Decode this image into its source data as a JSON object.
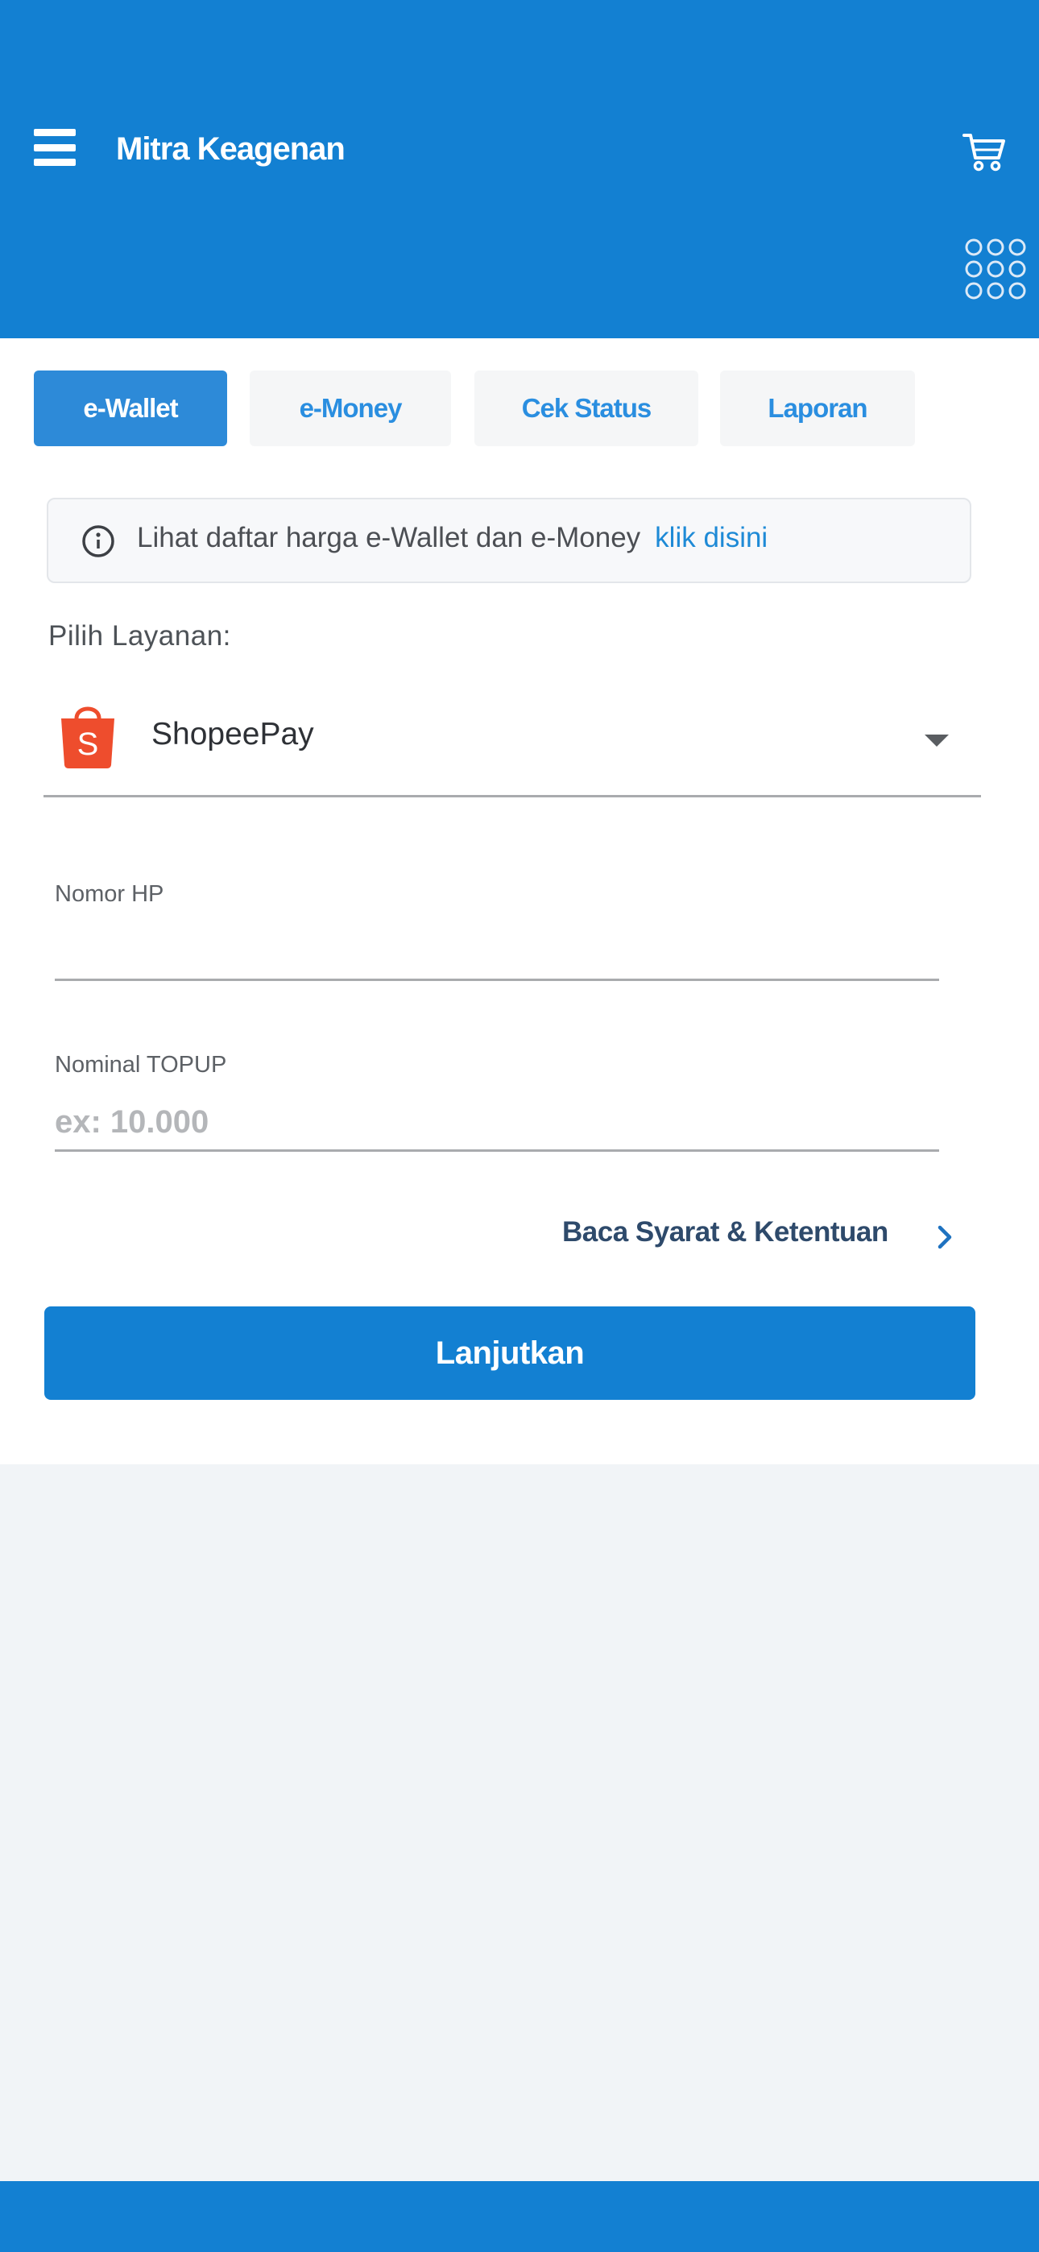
{
  "header": {
    "title": "Mitra Keagenan",
    "menu_icon": "hamburger-menu-icon",
    "cart_icon": "shopping-cart-icon",
    "apps_icon": "grid-dots-icon"
  },
  "tabs": [
    {
      "label": "e-Wallet",
      "active": true
    },
    {
      "label": "e-Money",
      "active": false
    },
    {
      "label": "Cek Status",
      "active": false
    },
    {
      "label": "Laporan",
      "active": false
    }
  ],
  "notice": {
    "icon": "info-icon",
    "text": "Lihat daftar harga e-Wallet dan e-Money",
    "link": "klik disini"
  },
  "service": {
    "label": "Pilih Layanan:",
    "selected": "ShopeePay",
    "logo_icon": "shopee-bag-icon"
  },
  "fields": {
    "phone": {
      "label": "Nomor HP",
      "value": "",
      "placeholder": ""
    },
    "topup": {
      "label": "Nominal TOPUP",
      "value": "",
      "placeholder": "ex: 10.000"
    }
  },
  "terms": {
    "label": "Baca Syarat & Ketentuan"
  },
  "submit": {
    "label": "Lanjutkan"
  },
  "colors": {
    "primary": "#1380d2",
    "tab_active": "#2d8ad8",
    "link": "#1e8ad6",
    "shopee": "#ee4d2d"
  }
}
